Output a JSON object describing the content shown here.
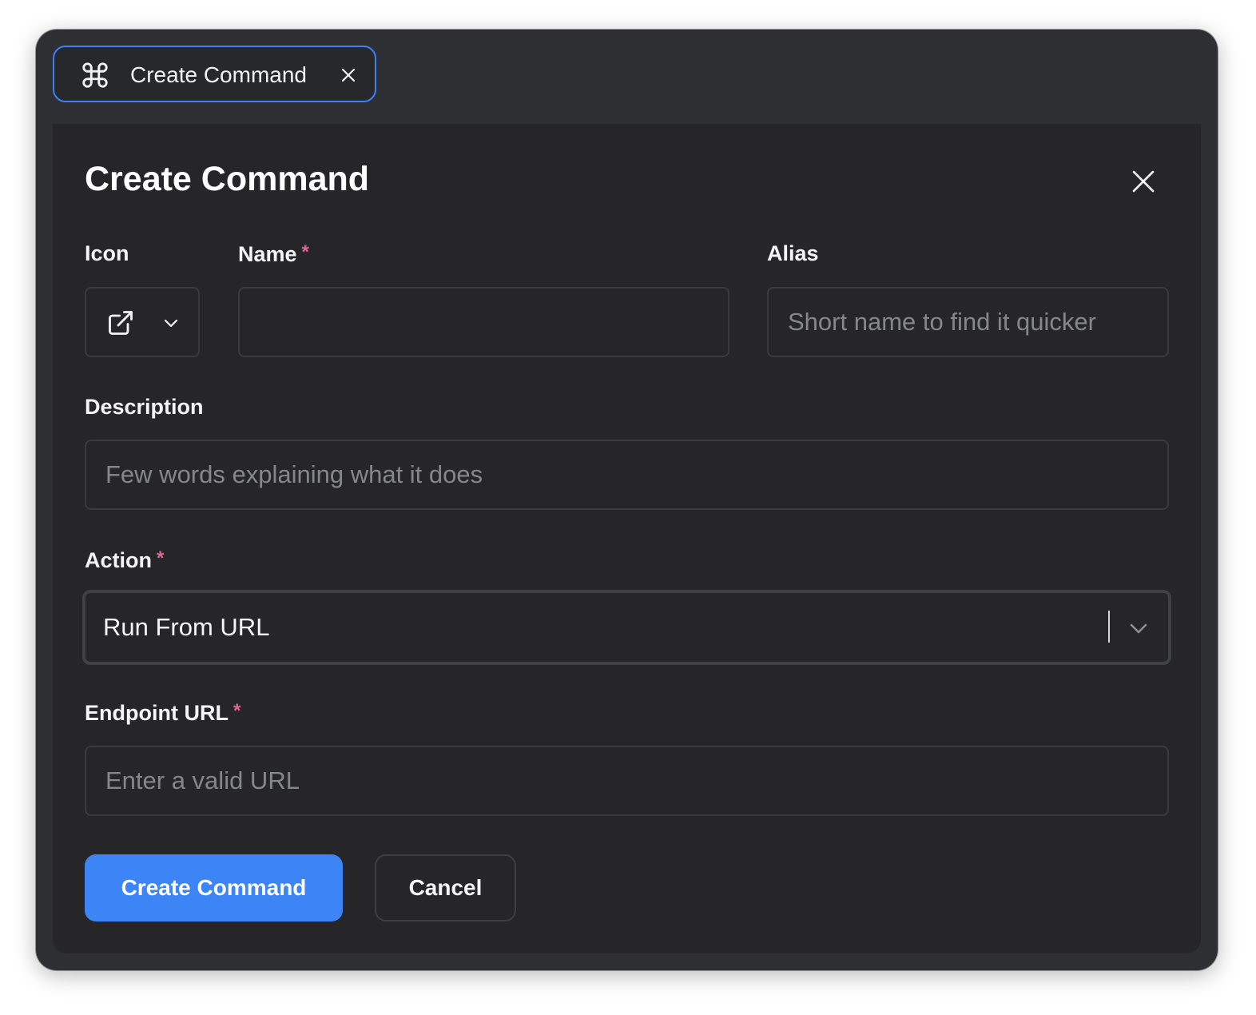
{
  "tab": {
    "label": "Create Command",
    "icon": "command-icon",
    "close_icon": "close-icon"
  },
  "dialog": {
    "title": "Create Command",
    "close_icon": "close-icon"
  },
  "form": {
    "icon": {
      "label": "Icon",
      "selected_icon": "external-link-icon"
    },
    "name": {
      "label": "Name",
      "required_mark": "*",
      "value": "",
      "placeholder": ""
    },
    "alias": {
      "label": "Alias",
      "value": "",
      "placeholder": "Short name to find it quicker"
    },
    "description": {
      "label": "Description",
      "value": "",
      "placeholder": "Few words explaining what it does"
    },
    "action": {
      "label": "Action",
      "required_mark": "*",
      "selected": "Run From URL"
    },
    "endpoint_url": {
      "label": "Endpoint URL",
      "required_mark": "*",
      "value": "",
      "placeholder": "Enter a valid URL"
    }
  },
  "buttons": {
    "submit_label": "Create Command",
    "cancel_label": "Cancel"
  },
  "colors": {
    "accent": "#3d85f7",
    "required": "#e0669a",
    "window_bg": "#2e2f33",
    "panel_bg": "#262628"
  }
}
